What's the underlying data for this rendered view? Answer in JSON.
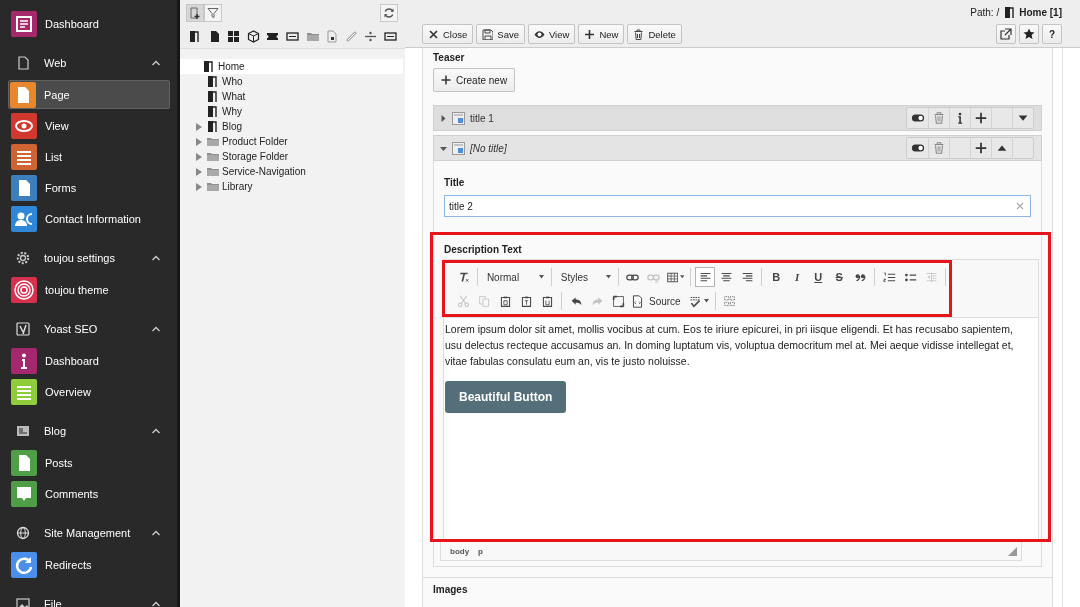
{
  "sidebar": [
    {
      "kind": "item",
      "label": "Dashboard",
      "color": "#a6286a",
      "selected": false
    },
    {
      "kind": "group",
      "label": "Web",
      "expanded": true,
      "children": [
        {
          "label": "Page",
          "color": "#e8872e",
          "selected": true
        },
        {
          "label": "View",
          "color": "#d2392e",
          "selected": false
        },
        {
          "label": "List",
          "color": "#cf6432",
          "selected": false
        },
        {
          "label": "Forms",
          "color": "#3b7fbd",
          "selected": false
        },
        {
          "label": "Contact Information",
          "color": "#2e87d8",
          "selected": false
        }
      ]
    },
    {
      "kind": "group",
      "label": "toujou settings",
      "expanded": true,
      "children": [
        {
          "label": "toujou theme",
          "color": "#d92f4f",
          "selected": false
        }
      ]
    },
    {
      "kind": "group",
      "label": "Yoast SEO",
      "expanded": true,
      "children": [
        {
          "label": "Dashboard",
          "color": "#a3286d",
          "selected": false
        },
        {
          "label": "Overview",
          "color": "#8fce3a",
          "selected": false
        }
      ]
    },
    {
      "kind": "group",
      "label": "Blog",
      "expanded": true,
      "children": [
        {
          "label": "Posts",
          "color": "#4e9f46",
          "selected": false
        },
        {
          "label": "Comments",
          "color": "#4f9e47",
          "selected": false
        }
      ]
    },
    {
      "kind": "group",
      "label": "Site Management",
      "expanded": true,
      "children": [
        {
          "label": "Redirects",
          "color": "#4b8fec",
          "selected": false
        }
      ]
    },
    {
      "kind": "group",
      "label": "File",
      "expanded": true
    }
  ],
  "tree": {
    "nodes": [
      {
        "label": "Home",
        "kind": "page",
        "selected": true,
        "children": [
          {
            "label": "Who",
            "kind": "page",
            "selected": false
          },
          {
            "label": "What",
            "kind": "page",
            "selected": false
          },
          {
            "label": "Why",
            "kind": "page",
            "selected": false
          },
          {
            "label": "Blog",
            "kind": "page",
            "selected": false,
            "expanded": false
          },
          {
            "label": "Product Folder",
            "kind": "folder",
            "selected": false,
            "expanded": false
          },
          {
            "label": "Storage Folder",
            "kind": "folder",
            "selected": false,
            "expanded": false
          },
          {
            "label": "Service-Navigation",
            "kind": "folder",
            "selected": false,
            "expanded": false
          },
          {
            "label": "Library",
            "kind": "folder",
            "selected": false,
            "expanded": false
          }
        ]
      }
    ]
  },
  "doc_header": {
    "path_label": "Path: /",
    "path_page": "Home [1]",
    "buttons": [
      "Close",
      "Save",
      "View",
      "New",
      "Delete"
    ],
    "help_label": "?"
  },
  "form": {
    "teaser_label": "Teaser",
    "create_button": "Create new",
    "records": [
      {
        "title": "title 1",
        "untitled": false,
        "expanded": false
      },
      {
        "title": "[No title]",
        "untitled": true,
        "expanded": true,
        "title_field": {
          "label": "Title",
          "value": "title 2"
        },
        "description": {
          "label": "Description Text",
          "highlighted": true,
          "toolbar": {
            "highlighted": true,
            "rows": [
              [
                {
                  "kind": "icon",
                  "disabled": false
                },
                {
                  "kind": "sep"
                },
                {
                  "kind": "dropdown",
                  "label": "Normal"
                },
                {
                  "kind": "sep"
                },
                {
                  "kind": "dropdown",
                  "label": "Styles"
                },
                {
                  "kind": "sep"
                },
                {
                  "kind": "icon",
                  "disabled": false
                },
                {
                  "kind": "icon",
                  "disabled": true
                },
                {
                  "kind": "menu",
                  "disabled": false
                },
                {
                  "kind": "sep"
                },
                {
                  "kind": "icon",
                  "disabled": false,
                  "selected": true
                },
                {
                  "kind": "icon",
                  "disabled": false,
                  "selected": false
                },
                {
                  "kind": "icon",
                  "disabled": false,
                  "selected": false
                },
                {
                  "kind": "sep"
                },
                {
                  "kind": "glyph",
                  "text": "B"
                },
                {
                  "kind": "glyph",
                  "text": "I"
                },
                {
                  "kind": "glyph",
                  "text": "U"
                },
                {
                  "kind": "glyph",
                  "text": "S"
                },
                {
                  "kind": "icon",
                  "disabled": false
                },
                {
                  "kind": "sep"
                },
                {
                  "kind": "icon",
                  "disabled": false
                },
                {
                  "kind": "icon",
                  "disabled": false
                },
                {
                  "kind": "icon",
                  "disabled": true
                },
                {
                  "kind": "sep"
                }
              ],
              [
                {
                  "kind": "icon",
                  "disabled": true
                },
                {
                  "kind": "icon",
                  "disabled": true
                },
                {
                  "kind": "icon",
                  "disabled": false
                },
                {
                  "kind": "icon",
                  "disabled": false
                },
                {
                  "kind": "icon",
                  "disabled": false
                },
                {
                  "kind": "sep"
                },
                {
                  "kind": "icon",
                  "disabled": false
                },
                {
                  "kind": "icon",
                  "disabled": true
                },
                {
                  "kind": "icon",
                  "disabled": false
                },
                {
                  "kind": "labeled",
                  "label": "Source",
                  "disabled": false
                },
                {
                  "kind": "menu",
                  "disabled": false
                },
                {
                  "kind": "sep"
                },
                {
                  "kind": "icon",
                  "disabled": false
                }
              ]
            ]
          },
          "body": "Lorem ipsum dolor sit amet, mollis vocibus at cum. Eos te iriure epicurei, in pri iisque eligendi. Et has recusabo sapientem, usu delectus recteque accusamus an. In doming luptatum vis, voluptua democritum mel at. Mei aeque vidisse intellegat et, vitae fabulas consulatu eum an, vis te justo noluisse.",
          "button": "Beautiful Button",
          "path": [
            "body",
            "p"
          ]
        }
      }
    ],
    "next_section_label": "Images"
  }
}
